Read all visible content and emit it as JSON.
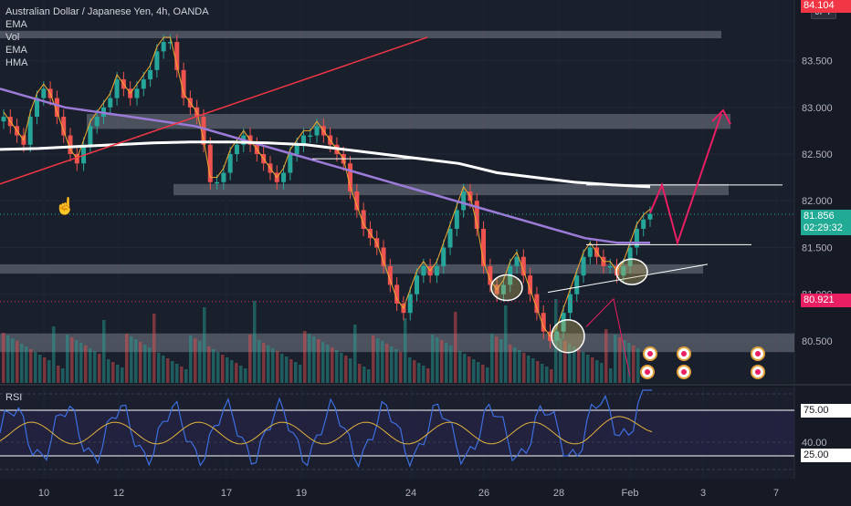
{
  "legend": {
    "title": "Australian Dollar / Japanese Yen, 4h, OANDA",
    "ind1": "EMA",
    "ind2": "Vol",
    "ind3": "EMA",
    "ind4": "HMA"
  },
  "currency_badge": "JPY",
  "rsi_label": "RSI",
  "price_tags": {
    "last_price": "81.856",
    "countdown": "02:29:32",
    "marked_level": "80.921",
    "top_level": "84.104"
  },
  "rsi_tags": {
    "upper": "75.00",
    "lower": "25.00"
  },
  "chart_data": {
    "type": "line",
    "title": "Australian Dollar / Japanese Yen, 4h, OANDA",
    "price_axis": {
      "ticks": [
        80.5,
        81.0,
        81.5,
        82.0,
        82.5,
        83.0,
        83.5
      ],
      "tick_labels": [
        "80.500",
        "81.000",
        "81.500",
        "82.000",
        "82.500",
        "83.000",
        "83.500"
      ],
      "ylim": [
        80.05,
        84.15
      ]
    },
    "rsi_axis": {
      "ticks": [
        75,
        40,
        25
      ],
      "tick_labels": [
        "75.00",
        "40.00",
        "25.00"
      ],
      "ylim": [
        0,
        100
      ]
    },
    "x_axis": {
      "tick_labels": [
        "10",
        "12",
        "17",
        "19",
        "24",
        "26",
        "28",
        "Feb",
        "3",
        "7"
      ]
    },
    "price_series": [
      {
        "name": "",
        "kind": "candles",
        "close": [
          82.9,
          82.8,
          82.7,
          82.6,
          82.9,
          83.1,
          83.2,
          83.1,
          82.9,
          82.7,
          82.5,
          82.4,
          82.6,
          82.8,
          82.9,
          83.0,
          83.1,
          83.3,
          83.2,
          83.1,
          83.2,
          83.3,
          83.4,
          83.6,
          83.7,
          83.7,
          83.4,
          83.1,
          83.0,
          82.9,
          82.6,
          82.2,
          82.2,
          82.3,
          82.5,
          82.6,
          82.7,
          82.6,
          82.5,
          82.4,
          82.3,
          82.2,
          82.3,
          82.5,
          82.6,
          82.7,
          82.7,
          82.8,
          82.7,
          82.6,
          82.5,
          82.4,
          82.1,
          81.9,
          81.7,
          81.6,
          81.5,
          81.3,
          81.1,
          80.9,
          80.8,
          81.0,
          81.2,
          81.3,
          81.2,
          81.3,
          81.5,
          81.7,
          81.9,
          82.1,
          82.0,
          81.7,
          81.3,
          81.1,
          81.0,
          81.1,
          81.3,
          81.4,
          81.2,
          81.0,
          80.8,
          80.6,
          80.5,
          80.6,
          80.8,
          81.0,
          81.2,
          81.4,
          81.5,
          81.4,
          81.3,
          81.3,
          81.2,
          81.3,
          81.5,
          81.7,
          81.8,
          81.86
        ]
      },
      {
        "name": "",
        "kind": "line",
        "color": "#9c7bd8",
        "values": [
          83.2,
          83.1,
          83.0,
          82.95,
          82.9,
          82.85,
          82.8,
          82.7,
          82.6,
          82.5,
          82.4,
          82.3,
          82.2,
          82.1,
          82.0,
          81.9,
          81.8,
          81.7,
          81.6,
          81.55,
          81.55
        ]
      },
      {
        "name": "",
        "kind": "line",
        "color": "#ffffff",
        "values": [
          82.55,
          82.56,
          82.58,
          82.6,
          82.62,
          82.63,
          82.63,
          82.62,
          82.6,
          82.55,
          82.5,
          82.45,
          82.4,
          82.3,
          82.25,
          82.2,
          82.17,
          82.15
        ]
      }
    ],
    "marked_levels": [
      81.856,
      80.921,
      84.104
    ],
    "rsi_series": [
      {
        "name": "RSI",
        "color": "#3d6fe0"
      },
      {
        "name": "",
        "color": "#e0b33d"
      }
    ],
    "grid": true,
    "legend_position": "top-left"
  }
}
